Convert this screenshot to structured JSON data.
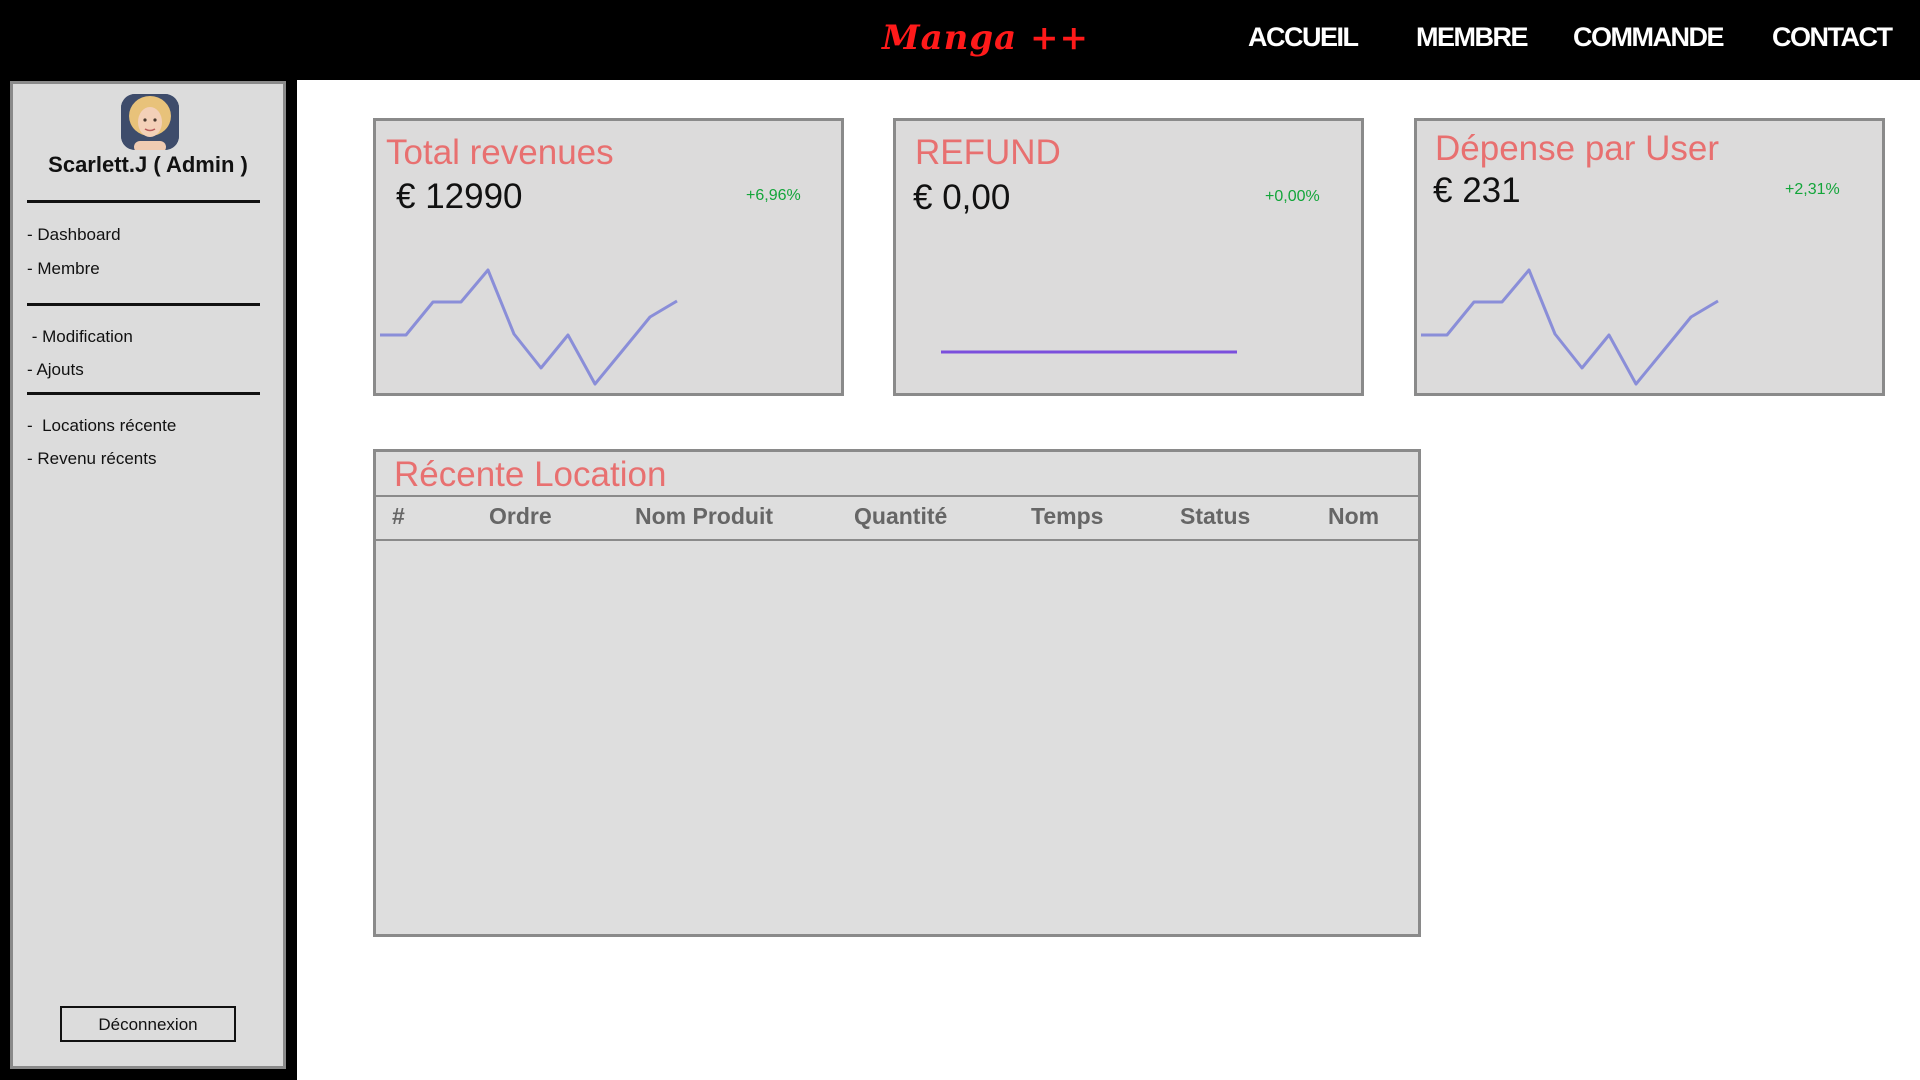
{
  "header": {
    "brand": "Manga ++",
    "nav": [
      "ACCUEIL",
      "MEMBRE",
      "COMMANDE",
      "CONTACT"
    ]
  },
  "sidebar": {
    "user": "Scarlett.J ( Admin )",
    "groups": [
      [
        "- Dashboard",
        "- Membre"
      ],
      [
        " - Modification",
        "- Ajouts"
      ],
      [
        "-  Locations récente",
        "- Revenu récents"
      ]
    ],
    "logout": "Déconnexion"
  },
  "cards": [
    {
      "title": "Total revenues",
      "value": "€ 12990",
      "change": "+6,96%"
    },
    {
      "title": "REFUND",
      "value": "€ 0,00",
      "change": "+0,00%"
    },
    {
      "title": "Dépense par User",
      "value": "€ 231",
      "change": "+2,31%"
    }
  ],
  "table": {
    "title": "Récente Location",
    "columns": [
      "#",
      "Ordre",
      "Nom Produit",
      "Quantité",
      "Temps",
      "Status",
      "Nom"
    ]
  },
  "colors": {
    "accent_title": "#e87070",
    "positive": "#13a53a",
    "brand": "#ff1a1a",
    "sparkline": "#8a8ed8",
    "refund_line": "#7b4fdc"
  }
}
